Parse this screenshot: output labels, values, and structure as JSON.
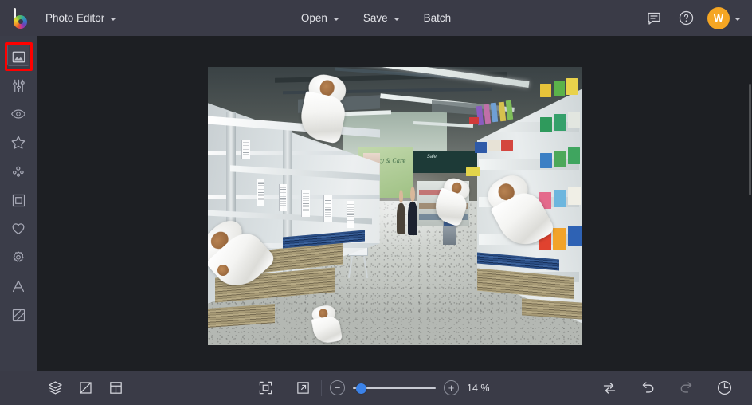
{
  "app": {
    "name": "Photo Editor",
    "logo_icon": "bc-color-wheel-logo"
  },
  "topbar": {
    "product_menu": {
      "label": "Photo Editor",
      "icon": "chevron-down-icon"
    },
    "actions": [
      {
        "label": "Open",
        "name": "open-button",
        "has_caret": true
      },
      {
        "label": "Save",
        "name": "save-button",
        "has_caret": true
      },
      {
        "label": "Batch",
        "name": "batch-button",
        "has_caret": false
      }
    ],
    "right": {
      "feedback_icon": "speech-bubble-icon",
      "help_icon": "question-circle-icon",
      "avatar_initial": "W",
      "avatar_color": "#f5a623",
      "account_caret_icon": "chevron-down-icon"
    }
  },
  "sidebar": {
    "highlight_color": "#ff0000",
    "items": [
      {
        "name": "sidebar-item-image",
        "icon": "image-mountain-icon",
        "label": "Image",
        "active": true
      },
      {
        "name": "sidebar-item-adjust",
        "icon": "sliders-icon",
        "label": "Adjust",
        "active": false
      },
      {
        "name": "sidebar-item-retouch",
        "icon": "eye-icon",
        "label": "Retouch",
        "active": false
      },
      {
        "name": "sidebar-item-effects",
        "icon": "star-icon",
        "label": "Effects",
        "active": false
      },
      {
        "name": "sidebar-item-overlays",
        "icon": "dots-cluster-icon",
        "label": "Overlays",
        "active": false
      },
      {
        "name": "sidebar-item-frames",
        "icon": "square-frame-icon",
        "label": "Frames",
        "active": false
      },
      {
        "name": "sidebar-item-favorites",
        "icon": "heart-icon",
        "label": "Favorites",
        "active": false
      },
      {
        "name": "sidebar-item-badges",
        "icon": "badge-scallop-icon",
        "label": "Badges",
        "active": false
      },
      {
        "name": "sidebar-item-text",
        "icon": "text-a-icon",
        "label": "Text",
        "active": false
      },
      {
        "name": "sidebar-item-watermark",
        "icon": "diagonal-stripe-icon",
        "label": "Watermark",
        "active": false
      }
    ]
  },
  "canvas": {
    "background_color": "#1d1f23",
    "image_alt": "Supermarket aisle with empty shelves and floating toilet paper rolls",
    "scrollbar": {
      "name": "canvas-vertical-scrollbar"
    },
    "scene_text": {
      "green_wall_sign": "Beauty & Care",
      "dark_band_sign": "Sale"
    }
  },
  "bottombar": {
    "left_tools": [
      {
        "name": "layers-button",
        "icon": "layers-stack-icon",
        "label": "Layers"
      },
      {
        "name": "crop-button",
        "icon": "crop-icon",
        "label": "Crop"
      },
      {
        "name": "layout-button",
        "icon": "layout-grid-icon",
        "label": "Layout"
      }
    ],
    "view_tools": [
      {
        "name": "fit-to-screen-button",
        "icon": "fit-screen-icon",
        "label": "Fit to screen"
      },
      {
        "name": "fullscreen-button",
        "icon": "expand-arrow-icon",
        "label": "Full screen"
      }
    ],
    "zoom": {
      "minus_label": "−",
      "plus_label": "+",
      "value": "14 %",
      "slider_percent": 4,
      "slider_color": "#3b82e8"
    },
    "right_tools": [
      {
        "name": "compare-button",
        "icon": "compare-swap-icon",
        "label": "Compare",
        "enabled": true
      },
      {
        "name": "undo-button",
        "icon": "undo-arrow-icon",
        "label": "Undo",
        "enabled": true
      },
      {
        "name": "redo-button",
        "icon": "redo-arrow-icon",
        "label": "Redo",
        "enabled": false
      },
      {
        "name": "history-button",
        "icon": "clock-history-icon",
        "label": "History",
        "enabled": true
      }
    ]
  }
}
